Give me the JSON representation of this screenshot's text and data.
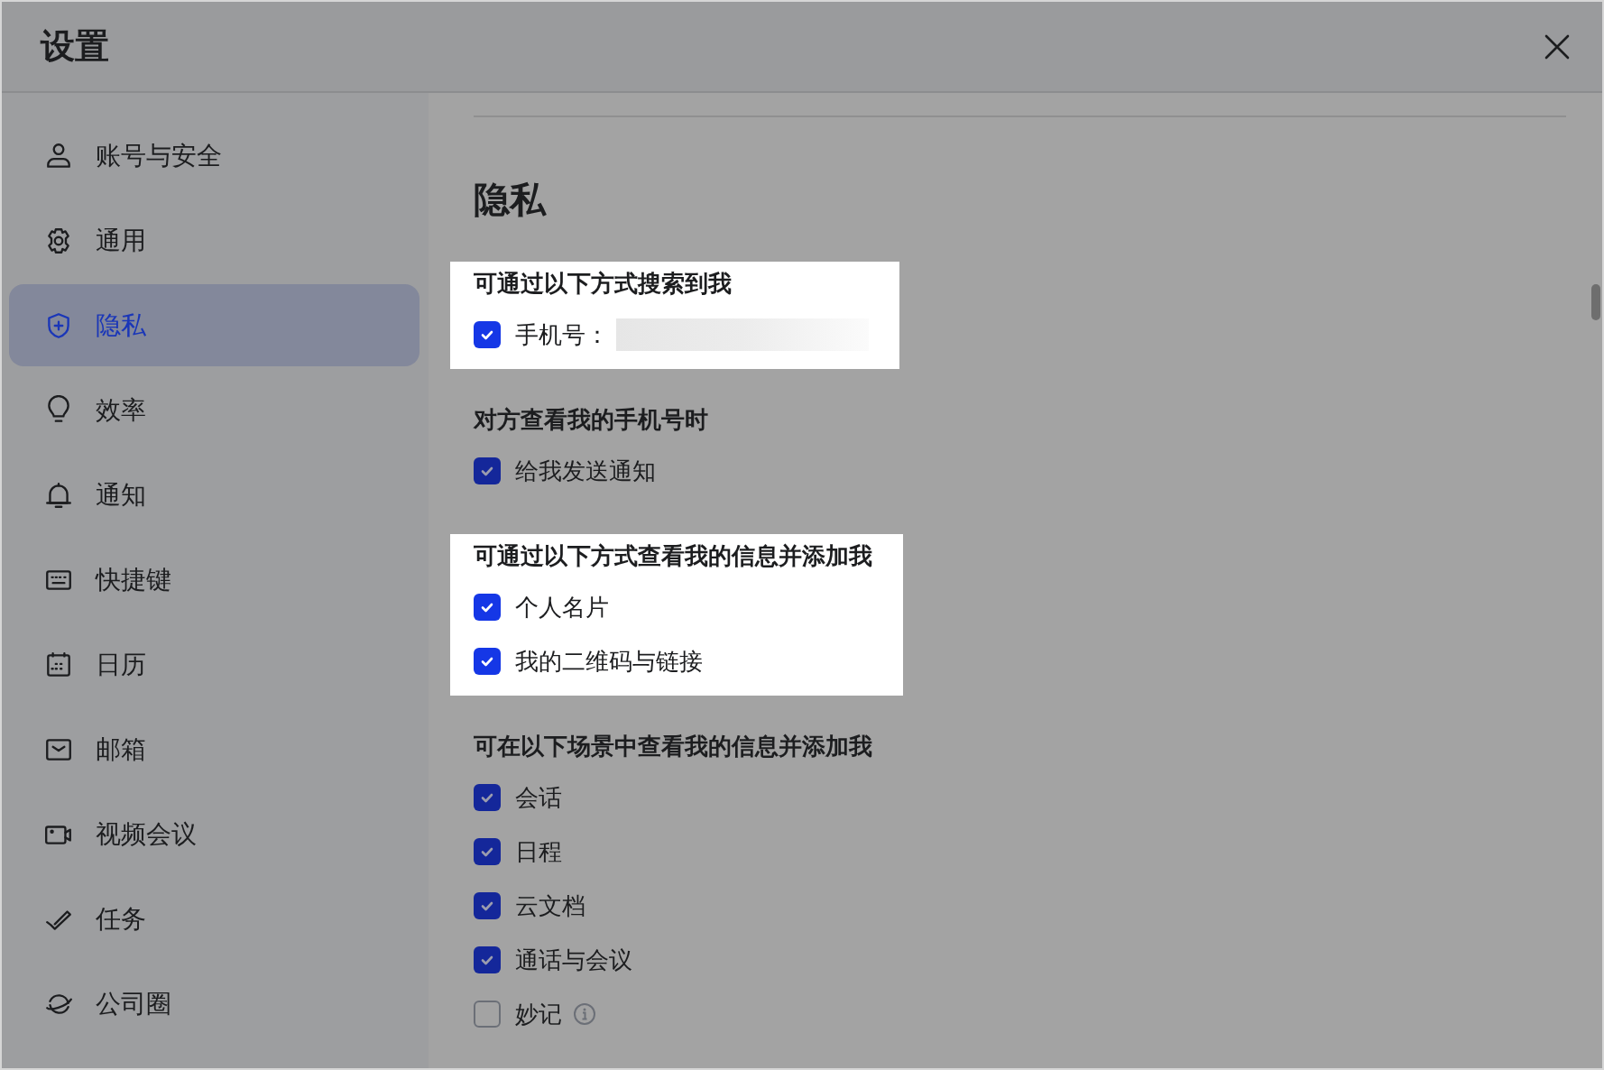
{
  "window": {
    "title": "设置"
  },
  "sidebar": {
    "items": [
      {
        "label": "账号与安全",
        "selected": false
      },
      {
        "label": "通用",
        "selected": false
      },
      {
        "label": "隐私",
        "selected": true
      },
      {
        "label": "效率",
        "selected": false
      },
      {
        "label": "通知",
        "selected": false
      },
      {
        "label": "快捷键",
        "selected": false
      },
      {
        "label": "日历",
        "selected": false
      },
      {
        "label": "邮箱",
        "selected": false
      },
      {
        "label": "视频会议",
        "selected": false
      },
      {
        "label": "任务",
        "selected": false
      },
      {
        "label": "公司圈",
        "selected": false
      }
    ]
  },
  "content": {
    "heading": "隐私",
    "sections": [
      {
        "title": "可通过以下方式搜索到我",
        "highlighted": true,
        "options": [
          {
            "label": "手机号：",
            "checked": true,
            "kind": "redacted"
          }
        ]
      },
      {
        "title": "对方查看我的手机号时",
        "highlighted": false,
        "options": [
          {
            "label": "给我发送通知",
            "checked": true,
            "kind": "plain"
          }
        ]
      },
      {
        "title": "可通过以下方式查看我的信息并添加我",
        "highlighted": true,
        "options": [
          {
            "label": "个人名片",
            "checked": true,
            "kind": "plain"
          },
          {
            "label": "我的二维码与链接",
            "checked": true,
            "kind": "plain"
          }
        ]
      },
      {
        "title": "可在以下场景中查看我的信息并添加我",
        "highlighted": false,
        "options": [
          {
            "label": "会话",
            "checked": true,
            "kind": "plain"
          },
          {
            "label": "日程",
            "checked": true,
            "kind": "plain"
          },
          {
            "label": "云文档",
            "checked": true,
            "kind": "plain"
          },
          {
            "label": "通话与会议",
            "checked": true,
            "kind": "plain"
          },
          {
            "label": "妙记",
            "checked": false,
            "kind": "info"
          }
        ]
      }
    ]
  }
}
